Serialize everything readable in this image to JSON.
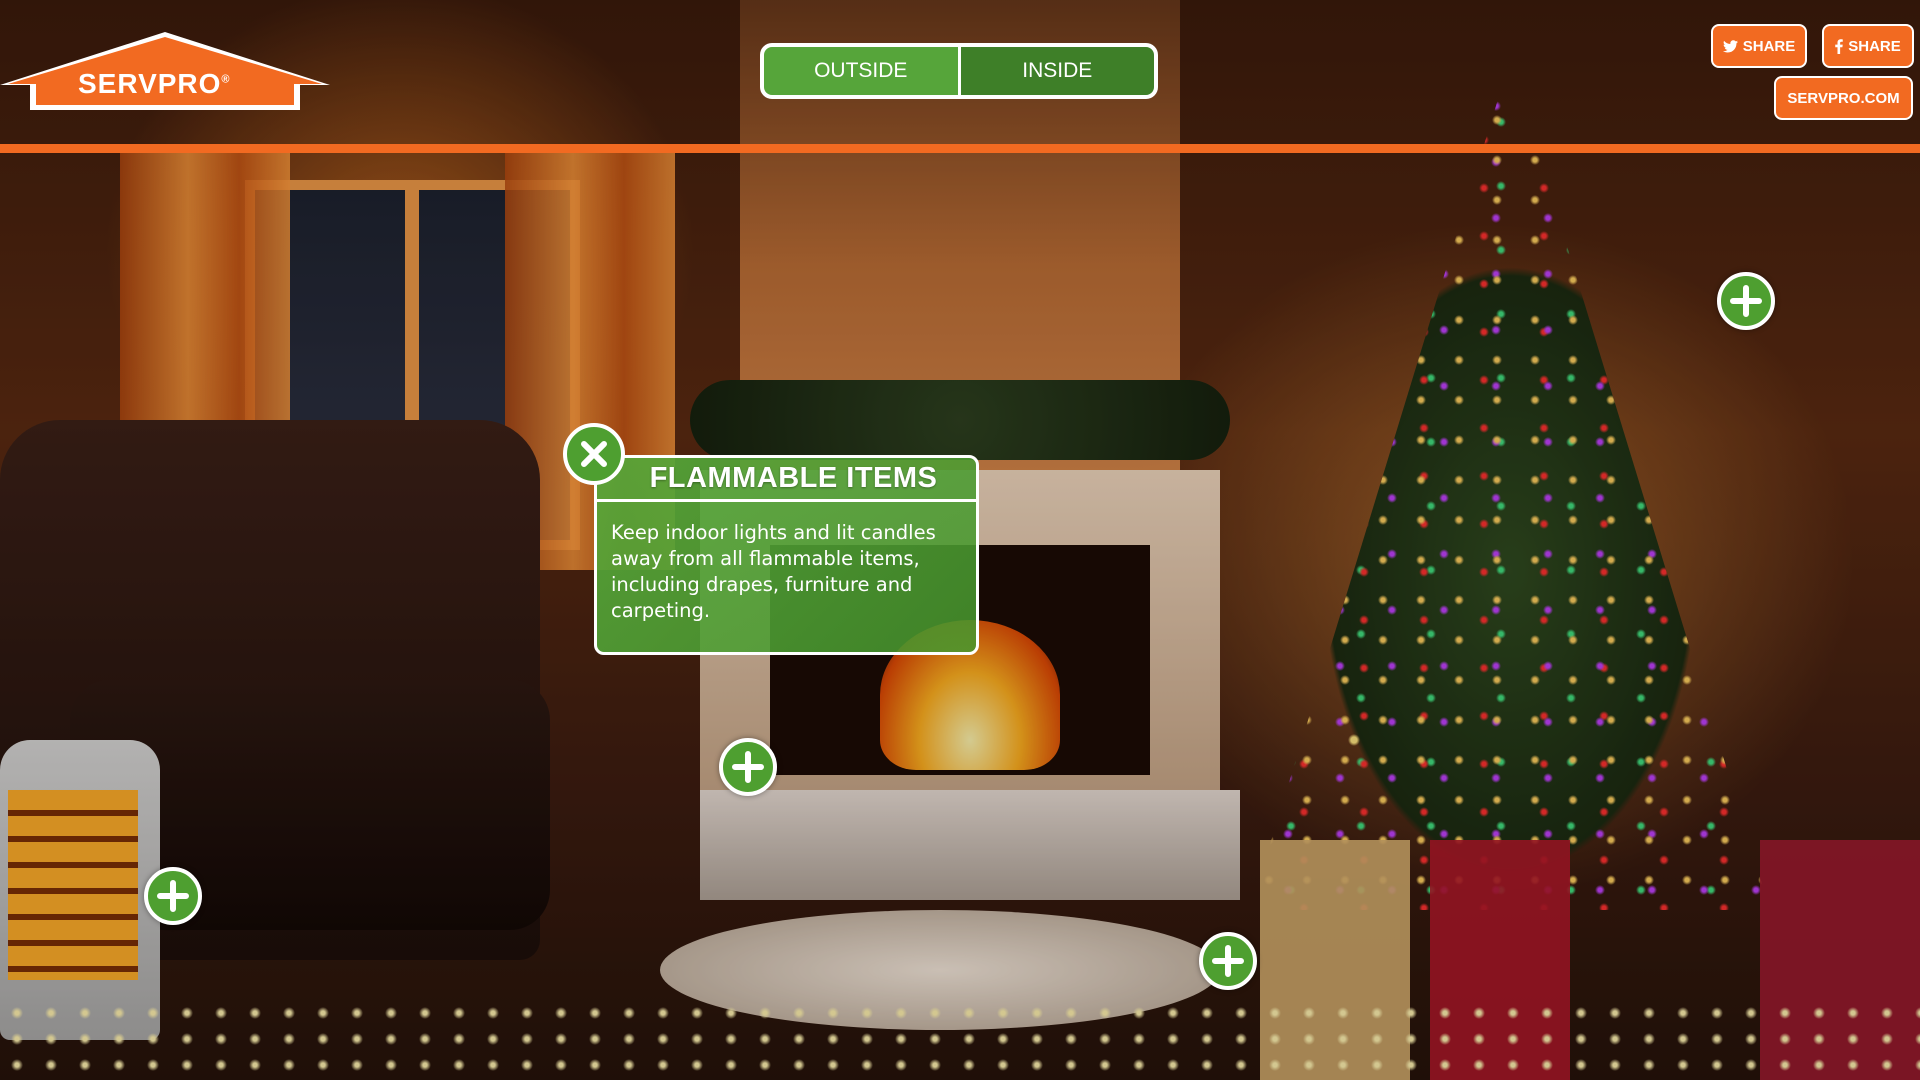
{
  "brand": {
    "logo_text": "SERVPRO",
    "registered_mark": "®",
    "accent": "#f26a21",
    "green": "#4e9f30"
  },
  "view_toggle": {
    "outside_label": "OUTSIDE",
    "inside_label": "INSIDE",
    "selected": "INSIDE"
  },
  "header_buttons": {
    "twitter_share_label": "SHARE",
    "twitter_icon": "twitter-icon",
    "facebook_share_label": "SHARE",
    "facebook_icon": "facebook-icon",
    "site_link_label": "SERVPRO.COM"
  },
  "popup": {
    "title": "FLAMMABLE ITEMS",
    "body": "Keep indoor lights and lit candles away from all flammable items, including drapes, furniture and carpeting.",
    "close_icon": "close-icon"
  },
  "hotspots": [
    {
      "name": "hotspot-christmas-tree",
      "icon": "plus-icon"
    },
    {
      "name": "hotspot-poinsettia",
      "icon": "plus-icon"
    },
    {
      "name": "hotspot-space-heater",
      "icon": "plus-icon"
    },
    {
      "name": "hotspot-gifts",
      "icon": "plus-icon"
    }
  ]
}
